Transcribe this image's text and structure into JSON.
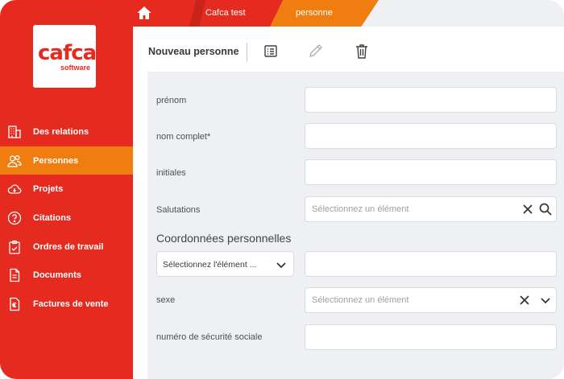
{
  "brand": {
    "logo_text": "cafca",
    "logo_sub": "software",
    "color_red": "#e52b1f",
    "color_orange": "#f07d10"
  },
  "breadcrumb": {
    "home_icon": "home-icon",
    "items": [
      "Cafca test",
      "personne"
    ]
  },
  "sidebar": {
    "items": [
      {
        "label": "Des relations",
        "icon": "building-icon"
      },
      {
        "label": "Personnes",
        "icon": "people-icon",
        "active": true
      },
      {
        "label": "Projets",
        "icon": "cloud-icon"
      },
      {
        "label": "Citations",
        "icon": "question-icon"
      },
      {
        "label": "Ordres de travail",
        "icon": "clipboard-icon"
      },
      {
        "label": "Documents",
        "icon": "document-icon"
      },
      {
        "label": "Factures de vente",
        "icon": "euro-invoice-icon"
      }
    ]
  },
  "header": {
    "title": "Nouveau personne",
    "tools": [
      "list-icon",
      "pencil-icon",
      "trash-icon"
    ]
  },
  "form": {
    "prenom_label": "prénom",
    "nom_label": "nom complet*",
    "initiales_label": "initiales",
    "salutations_label": "Salutations",
    "salutations_placeholder": "Sélectionnez un élément",
    "section_title": "Coordonnées personnelles",
    "coord_select_value": "Sélectionnez l'élément ...",
    "sexe_label": "sexe",
    "sexe_placeholder": "Sélectionnez un élément",
    "nss_label": "numéro de sécurité sociale"
  }
}
